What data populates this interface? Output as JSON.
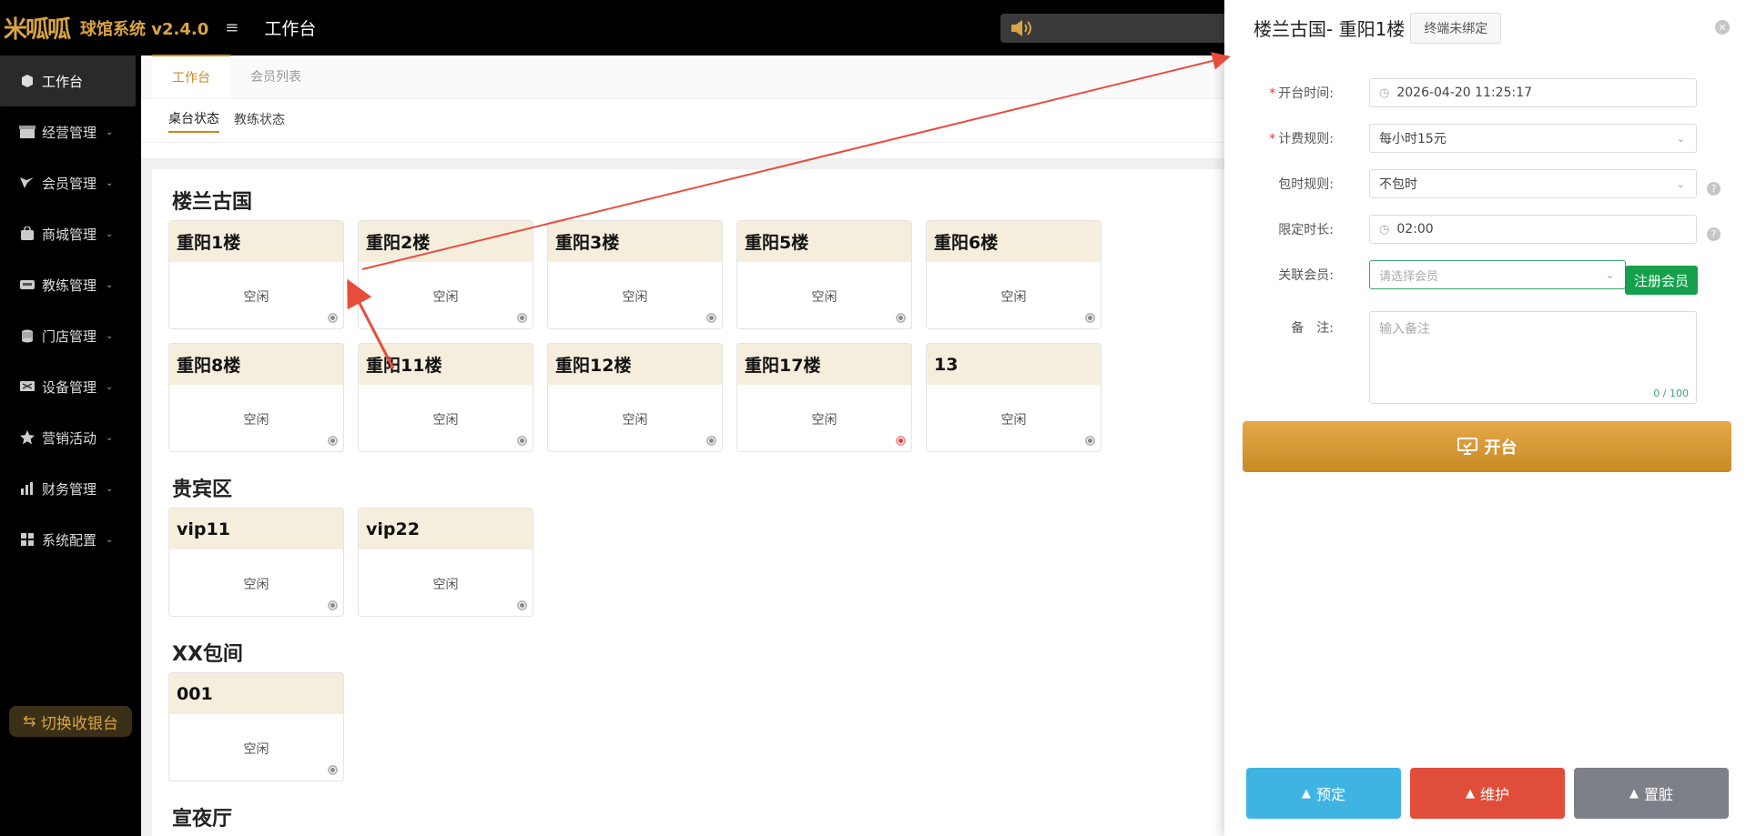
{
  "app": {
    "logo_text": "米呱呱",
    "title": "球馆系统 v2.4.0",
    "page_title": "工作台"
  },
  "sidebar": {
    "items": [
      {
        "label": "工作台",
        "icon": "cube-icon"
      },
      {
        "label": "经营管理",
        "icon": "store-icon"
      },
      {
        "label": "会员管理",
        "icon": "vip-icon"
      },
      {
        "label": "商城管理",
        "icon": "bag-icon"
      },
      {
        "label": "教练管理",
        "icon": "coach-icon"
      },
      {
        "label": "门店管理",
        "icon": "coins-icon"
      },
      {
        "label": "设备管理",
        "icon": "device-icon"
      },
      {
        "label": "营销活动",
        "icon": "star-icon"
      },
      {
        "label": "财务管理",
        "icon": "chart-icon"
      },
      {
        "label": "系统配置",
        "icon": "grid-icon"
      }
    ],
    "switch_label": "切换收银台"
  },
  "tabs": [
    "工作台",
    "会员列表"
  ],
  "subtabs": [
    "桌台状态",
    "教练状态"
  ],
  "zones": [
    {
      "name": "楼兰古国",
      "tables": [
        {
          "name": "重阳1楼",
          "status": "空闲"
        },
        {
          "name": "重阳2楼",
          "status": "空闲"
        },
        {
          "name": "重阳3楼",
          "status": "空闲"
        },
        {
          "name": "重阳5楼",
          "status": "空闲"
        },
        {
          "name": "重阳6楼",
          "status": "空闲"
        },
        {
          "name": "重阳8楼",
          "status": "空闲"
        },
        {
          "name": "重阳11楼",
          "status": "空闲"
        },
        {
          "name": "重阳12楼",
          "status": "空闲"
        },
        {
          "name": "重阳17楼",
          "status": "空闲"
        },
        {
          "name": "13",
          "status": "空闲"
        }
      ]
    },
    {
      "name": "贵宾区",
      "tables": [
        {
          "name": "vip11",
          "status": "空闲"
        },
        {
          "name": "vip22",
          "status": "空闲"
        }
      ]
    },
    {
      "name": "XX包间",
      "tables": [
        {
          "name": "001",
          "status": "空闲"
        }
      ]
    },
    {
      "name": "宣夜厅",
      "tables": []
    }
  ],
  "drawer": {
    "title": "楼兰古国- 重阳1楼",
    "tag": "终端未绑定",
    "fields": {
      "open_time_label": "开台时间:",
      "open_time_value": "2026-04-20 11:25:17",
      "billing_label": "计费规则:",
      "billing_value": "每小时15元",
      "package_label": "包时规则:",
      "package_value": "不包时",
      "limit_label": "限定时长:",
      "limit_value": "02:00",
      "member_label": "关联会员:",
      "member_placeholder": "请选择会员",
      "register_label": "注册会员",
      "remark_label": "备　注:",
      "remark_placeholder": "输入备注",
      "remark_counter": "0 / 100"
    },
    "open_label": "开台",
    "reserve_label": "预定",
    "maintain_label": "维护",
    "dirty_label": "置脏"
  },
  "colors": {
    "accent": "#c88a22",
    "card_head": "#f6eedd",
    "register_green": "#15a04c",
    "reserve_blue": "#3fb4e2",
    "maint_red": "#e04d3b",
    "dirty_gray": "#7d8088",
    "annotation_red": "#e84c3d"
  }
}
